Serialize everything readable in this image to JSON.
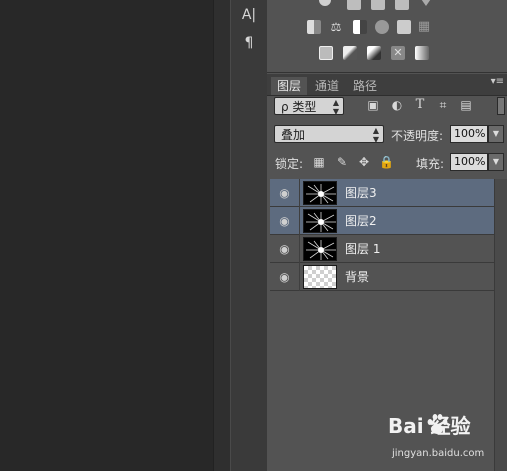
{
  "left_tools": [
    {
      "icon": "character-panel-icon",
      "glyph": "A|"
    },
    {
      "icon": "paragraph-panel-icon",
      "glyph": "¶"
    }
  ],
  "adjustments": {
    "icons": [
      "brightness-icon",
      "levels-icon",
      "curves-icon",
      "exposure-icon",
      "vibrance-icon",
      "color-balance-icon",
      "black-white-icon",
      "photo-filter-icon",
      "channel-mixer-icon",
      "color-lookup-icon",
      "invert-icon",
      "posterize-icon",
      "threshold-icon",
      "selective-color-icon",
      "gradient-map-icon"
    ]
  },
  "tabs": [
    {
      "label": "图层",
      "active": true
    },
    {
      "label": "通道",
      "active": false
    },
    {
      "label": "路径",
      "active": false
    }
  ],
  "filter": {
    "kind_label": "ρ 类型",
    "icons": [
      "pixel-filter-icon",
      "adjustment-filter-icon",
      "type-filter-icon",
      "shape-filter-icon",
      "smart-object-filter-icon"
    ]
  },
  "blend": {
    "mode": "叠加",
    "opacity_label": "不透明度:",
    "opacity_value": "100%"
  },
  "lock": {
    "label": "锁定:",
    "icons": [
      "lock-transparent-icon",
      "lock-image-icon",
      "lock-position-icon",
      "lock-all-icon"
    ],
    "fill_label": "填充:",
    "fill_value": "100%"
  },
  "layers": [
    {
      "name": "图层3",
      "thumb": "black",
      "selected": true
    },
    {
      "name": "图层2",
      "thumb": "black",
      "selected": true
    },
    {
      "name": "图层 1",
      "thumb": "black",
      "selected": false
    },
    {
      "name": "背景",
      "thumb": "transparent",
      "selected": false
    }
  ],
  "watermark": {
    "brand": "Bai 经验",
    "url": "jingyan.baidu.com"
  },
  "colors": {
    "panel": "#535353",
    "selection": "#5d6b7f",
    "canvas": "#282828"
  }
}
